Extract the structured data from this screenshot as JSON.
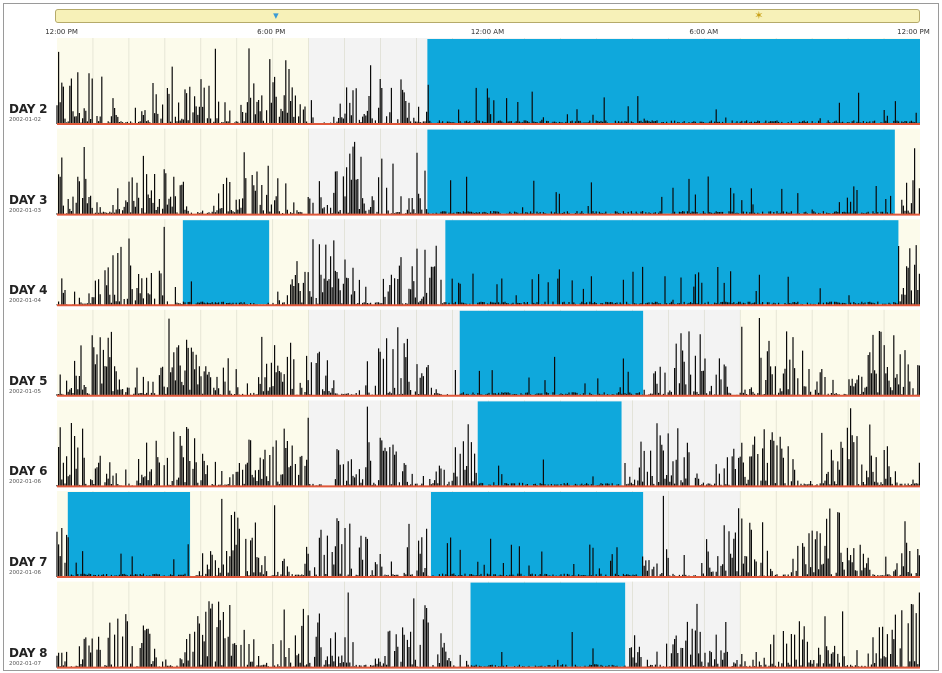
{
  "chart_data": {
    "type": "bar",
    "x_axis": {
      "range_hours": [
        0,
        24
      ],
      "tick_hours": [
        0,
        6,
        12,
        18,
        24
      ],
      "tick_labels": [
        "12:00 PM",
        "6:00 PM",
        "12:00 AM",
        "6:00 AM",
        "12:00 PM"
      ]
    },
    "grid": true,
    "scrubber_marker_hours": [
      6.1,
      19.5
    ],
    "rows": [
      {
        "day": "DAY 2",
        "date": "2002-01-02",
        "highlight_hours": [
          [
            10.3,
            24.0
          ]
        ],
        "peak_level": 1.0
      },
      {
        "day": "DAY 3",
        "date": "2002-01-03",
        "highlight_hours": [
          [
            10.3,
            23.3
          ]
        ],
        "peak_level": 0.9
      },
      {
        "day": "DAY 4",
        "date": "2002-01-04",
        "highlight_hours": [
          [
            3.5,
            5.9
          ],
          [
            10.8,
            23.4
          ]
        ],
        "peak_level": 1.0
      },
      {
        "day": "DAY 5",
        "date": "2002-01-05",
        "highlight_hours": [
          [
            11.2,
            16.3
          ]
        ],
        "peak_level": 1.0
      },
      {
        "day": "DAY 6",
        "date": "2002-01-06",
        "highlight_hours": [
          [
            11.7,
            15.7
          ]
        ],
        "peak_level": 1.0
      },
      {
        "day": "DAY 7",
        "date": "2002-01-06",
        "highlight_hours": [
          [
            0.3,
            3.7
          ],
          [
            10.4,
            16.3
          ]
        ],
        "peak_level": 1.0
      },
      {
        "day": "DAY 8",
        "date": "2002-01-07",
        "highlight_hours": [
          [
            11.5,
            15.8
          ]
        ],
        "peak_level": 1.0
      }
    ],
    "colors": {
      "highlight": "#0fa8dc",
      "bars": "#0b0b0b",
      "baseline": "#e0583a",
      "day_background": "#fcfbeb",
      "night_background": "#f3f3f3",
      "grid": "#d8d8c8"
    }
  }
}
